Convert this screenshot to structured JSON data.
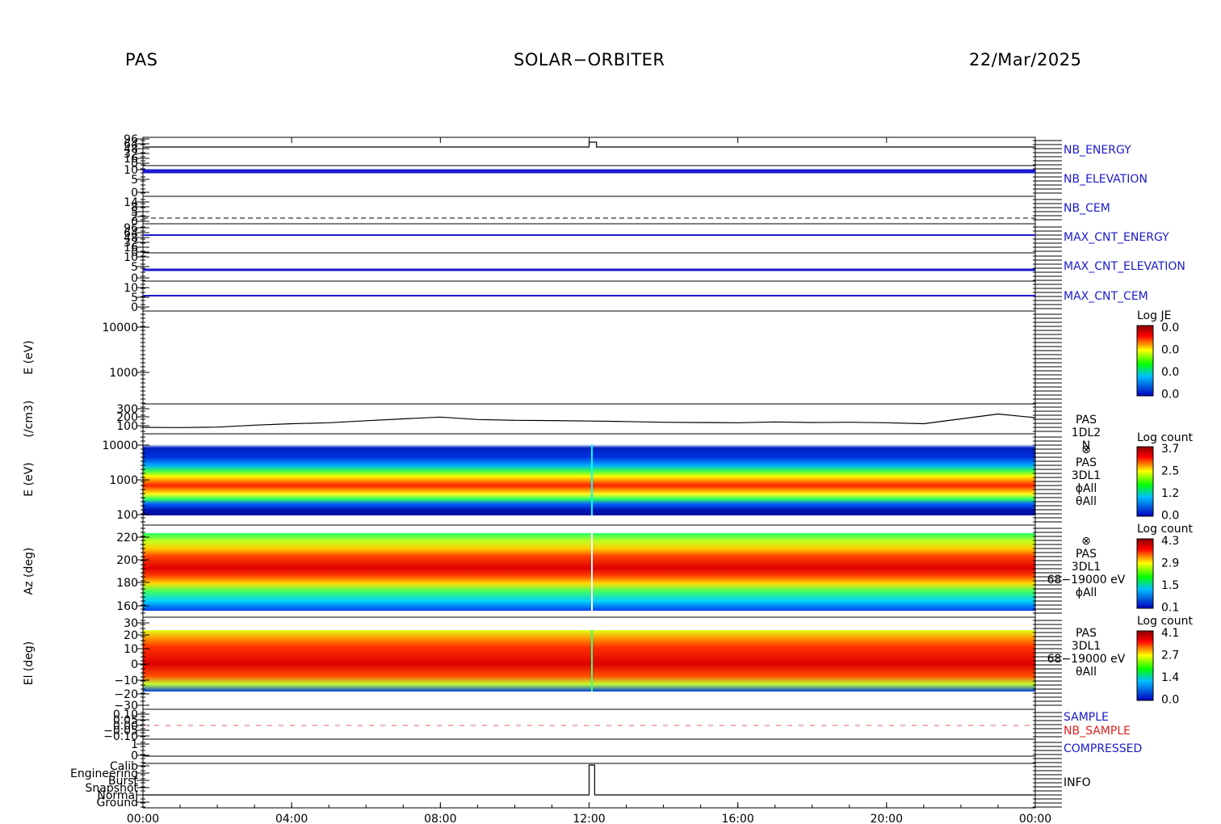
{
  "header": {
    "instrument": "PAS",
    "mission": "SOLAR−ORBITER",
    "date": "22/Mar/2025"
  },
  "chart_data": {
    "type": "multi-panel time series / spectrogram",
    "x_ticks": [
      "00:00",
      "04:00",
      "08:00",
      "12:00",
      "16:00",
      "20:00",
      "00:00"
    ],
    "panels": [
      {
        "id": "nb_energy",
        "type": "line",
        "label": "NB_ENERGY",
        "label_color": "#1a1acc",
        "y_ticks": [
          "96",
          "64",
          "48",
          "32",
          "16",
          "0"
        ],
        "series": [
          {
            "x": [
              0,
              12.0,
              12.0,
              12.2,
              12.2,
              24
            ],
            "y": [
              0,
              0,
              1,
              1,
              0,
              0
            ]
          }
        ]
      },
      {
        "id": "nb_elevation",
        "type": "line",
        "label": "NB_ELEVATION",
        "label_color": "#1a1acc",
        "y_ticks": [
          "10",
          "5",
          "0"
        ]
      },
      {
        "id": "nb_cem",
        "type": "line",
        "label": "NB_CEM",
        "label_color": "#1a1acc",
        "y_ticks": [
          "14",
          "8",
          "5",
          "2",
          "0"
        ]
      },
      {
        "id": "max_cnt_energy",
        "type": "line",
        "label": "MAX_CNT_ENERGY",
        "label_color": "#1a1acc",
        "y_ticks": [
          "96",
          "64",
          "48",
          "32",
          "16",
          "0"
        ]
      },
      {
        "id": "max_cnt_elevation",
        "type": "line",
        "label": "MAX_CNT_ELEVATION",
        "label_color": "#1a1acc",
        "y_ticks": [
          "10",
          "5",
          "0"
        ]
      },
      {
        "id": "max_cnt_cem",
        "type": "line",
        "label": "MAX_CNT_CEM",
        "label_color": "#1a1acc",
        "y_ticks": [
          "10",
          "5",
          "0"
        ]
      },
      {
        "id": "ion_energy_1",
        "type": "spectrogram",
        "ylabel": "E (eV)",
        "y_ticks": [
          "10000",
          "1000"
        ],
        "colorbar": {
          "title": "Log JE",
          "ticks": [
            "0.0",
            "0.0",
            "0.0",
            "0.0"
          ]
        }
      },
      {
        "id": "density",
        "type": "line",
        "ylabel": "(/cm3)",
        "y_ticks": [
          "300",
          "200",
          "100"
        ],
        "side_labels": [
          "PAS",
          "1DL2",
          "N"
        ],
        "series": [
          {
            "name": "N",
            "x": [
              0,
              1,
              2,
              3,
              4,
              5,
              6,
              7,
              8,
              9,
              10,
              11,
              12,
              13,
              14,
              15,
              16,
              17,
              18,
              19,
              20,
              21,
              22,
              23,
              24
            ],
            "y": [
              120,
              118,
              122,
              138,
              150,
              158,
              175,
              190,
              205,
              185,
              178,
              176,
              172,
              168,
              162,
              160,
              158,
              165,
              160,
              162,
              158,
              150,
              190,
              230,
              200
            ]
          }
        ]
      },
      {
        "id": "energy_spec",
        "type": "spectrogram",
        "ylabel": "E (eV)",
        "y_ticks": [
          "10000",
          "1000",
          "100"
        ],
        "side_labels": [
          "⊗",
          "PAS",
          "3DL1",
          "ϕAll",
          "θAll"
        ],
        "colorbar": {
          "title": "Log count",
          "ticks": [
            "3.7",
            "2.5",
            "1.2",
            "0.0"
          ]
        }
      },
      {
        "id": "az_spec",
        "type": "spectrogram",
        "ylabel": "Az (deg)",
        "y_ticks": [
          "220",
          "200",
          "180",
          "160"
        ],
        "side_labels": [
          "⊗",
          "PAS",
          "3DL1",
          "68−19000 eV",
          "ϕAll"
        ],
        "colorbar": {
          "title": "Log count",
          "ticks": [
            "4.3",
            "2.9",
            "1.5",
            "0.1"
          ]
        }
      },
      {
        "id": "el_spec",
        "type": "spectrogram",
        "ylabel": "El (deg)",
        "y_ticks": [
          "30",
          "20",
          "10",
          "0",
          "−10",
          "−20",
          "−30"
        ],
        "side_labels": [
          "PAS",
          "3DL1",
          "68−19000 eV",
          "θAll"
        ],
        "colorbar": {
          "title": "Log count",
          "ticks": [
            "4.1",
            "2.7",
            "1.4",
            "0.0"
          ]
        }
      },
      {
        "id": "sample",
        "type": "line",
        "labels": [
          {
            "text": "SAMPLE",
            "color": "#1a1acc"
          },
          {
            "text": "NB_SAMPLE",
            "color": "#e02020"
          }
        ],
        "y_ticks": [
          "0.10",
          "0.05",
          "0.00",
          "−0.05",
          "−0.10"
        ]
      },
      {
        "id": "compressed",
        "type": "line",
        "label": "COMPRESSED",
        "label_color": "#1a1acc",
        "y_ticks": [
          "1",
          "0"
        ]
      },
      {
        "id": "info",
        "type": "line",
        "label": "INFO",
        "label_color": "#000000",
        "y_ticks": [
          "Calib",
          "Engineering",
          "Burst",
          "Snapshot",
          "Normal",
          "Ground"
        ],
        "series": [
          {
            "x": [
              0,
              12.0,
              12.0,
              12.15,
              12.15,
              24
            ],
            "y": [
              0,
              0,
              5,
              5,
              0,
              0
            ]
          }
        ]
      }
    ]
  }
}
